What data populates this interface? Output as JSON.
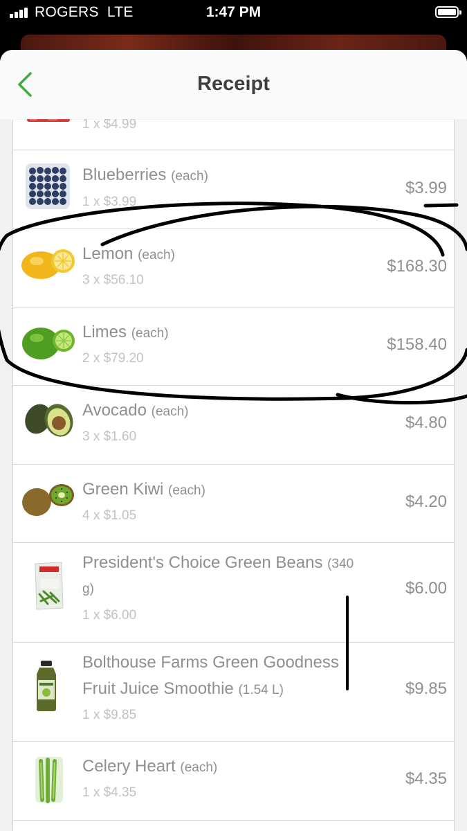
{
  "status": {
    "carrier": "ROGERS",
    "network": "LTE",
    "time": "1:47 PM"
  },
  "nav": {
    "title": "Receipt"
  },
  "items": [
    {
      "name": "",
      "unit": "",
      "qty": "1 x $4.99",
      "price": ""
    },
    {
      "name": "Blueberries",
      "unit": "(each)",
      "qty": "1 x $3.99",
      "price": "$3.99"
    },
    {
      "name": "Lemon",
      "unit": "(each)",
      "qty": "3 x $56.10",
      "price": "$168.30"
    },
    {
      "name": "Limes",
      "unit": "(each)",
      "qty": "2 x $79.20",
      "price": "$158.40"
    },
    {
      "name": "Avocado",
      "unit": "(each)",
      "qty": "3 x $1.60",
      "price": "$4.80"
    },
    {
      "name": "Green Kiwi",
      "unit": "(each)",
      "qty": "4 x $1.05",
      "price": "$4.20"
    },
    {
      "name": "President's Choice Green Beans",
      "unit": "(340",
      "name2": "g)",
      "qty": "1 x $6.00",
      "price": "$6.00"
    },
    {
      "name": "Bolthouse Farms Green Goodness",
      "name2": "Fruit Juice Smoothie",
      "unit": "(1.54 L)",
      "qty": "1 x $9.85",
      "price": "$9.85"
    },
    {
      "name": "Celery Heart",
      "unit": "(each)",
      "qty": "1 x $4.35",
      "price": "$4.35"
    }
  ],
  "colors": {
    "accent": "#3fae3f",
    "text": "#8f8f8f",
    "subtext": "#c2c2c2"
  },
  "icons": {
    "back": "chevron-left-icon"
  }
}
